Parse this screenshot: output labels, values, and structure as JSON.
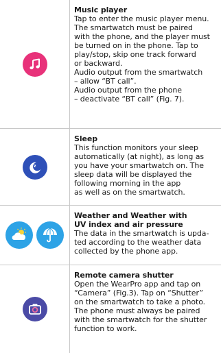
{
  "sections": [
    {
      "icon": "music-note-icon",
      "icon_color": "#e8327a",
      "title": "Music player",
      "lines": [
        "Tap to enter the music player menu.",
        "The smartwatch must be paired",
        "with the phone, and the player must",
        "be turned on in the phone. Tap to",
        "play/stop, skip one track forward",
        "or backward.",
        "Audio output from the smartwatch",
        "– allow “BT call”.",
        "Audio output from the phone",
        "– deactivate “BT call” (Fig. 7)."
      ]
    },
    {
      "icon": "sleep-moon-icon",
      "icon_color": "#2e50b8",
      "title": "Sleep",
      "lines": [
        "This function monitors your sleep",
        "automatically (at night), as long as",
        "you have your smartwatch on. The",
        "sleep data will be displayed the",
        "following morning in the app",
        "as well as on the smartwatch."
      ]
    },
    {
      "icons": [
        "weather-sun-cloud-icon",
        "umbrella-icon"
      ],
      "icon_color": "#2da3e6",
      "title_lines": [
        "Weather and Weather with",
        "UV index and air pressure"
      ],
      "lines": [
        "The data in the smartwatch is upda-",
        "ted according to the weather data",
        "collected by the phone app."
      ]
    },
    {
      "icon": "camera-icon",
      "icon_color": "#4b4ba6",
      "title": "Remote camera shutter",
      "lines": [
        "Open the WearPro app and tap on",
        "“Camera” (Fig.3). Tap on “Shutter”",
        "on the smartwatch to take a photo.",
        "The phone must always be paired",
        "with the smartwatch for the shutter",
        "function to work."
      ]
    }
  ]
}
